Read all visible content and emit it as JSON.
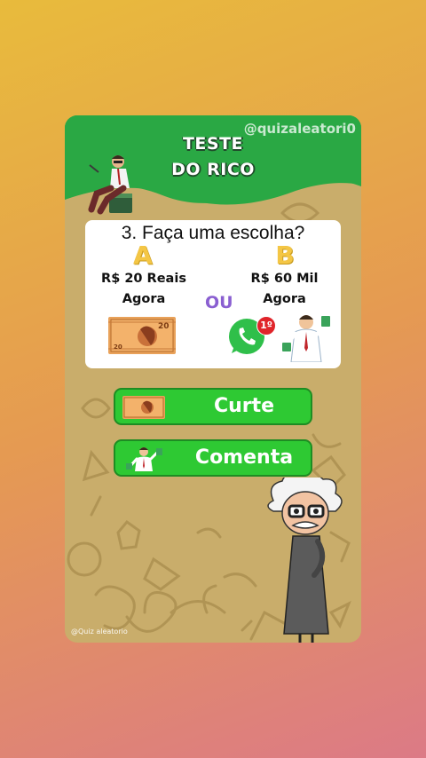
{
  "card": {
    "title_line1": "TESTE",
    "title_line2": "DO RICO",
    "handle": "@quizaleatori0",
    "watermark": "@Quiz aleatorio"
  },
  "question": {
    "text": "3. Faça uma escolha?",
    "option_a": {
      "letter": "A",
      "line1": "R$ 20 Reais",
      "line2": "Agora",
      "bill_value": "20"
    },
    "option_b": {
      "letter": "B",
      "line1": "R$ 60 Mil",
      "line2": "Agora"
    },
    "separator": "OU",
    "badge": "1º"
  },
  "buttons": {
    "like_label": "Curte",
    "comment_label": "Comenta"
  },
  "colors": {
    "green_header": "#2aa844",
    "button_green": "#2ec933",
    "option_letter": "#f4c645",
    "separator": "#8a5fd1"
  }
}
